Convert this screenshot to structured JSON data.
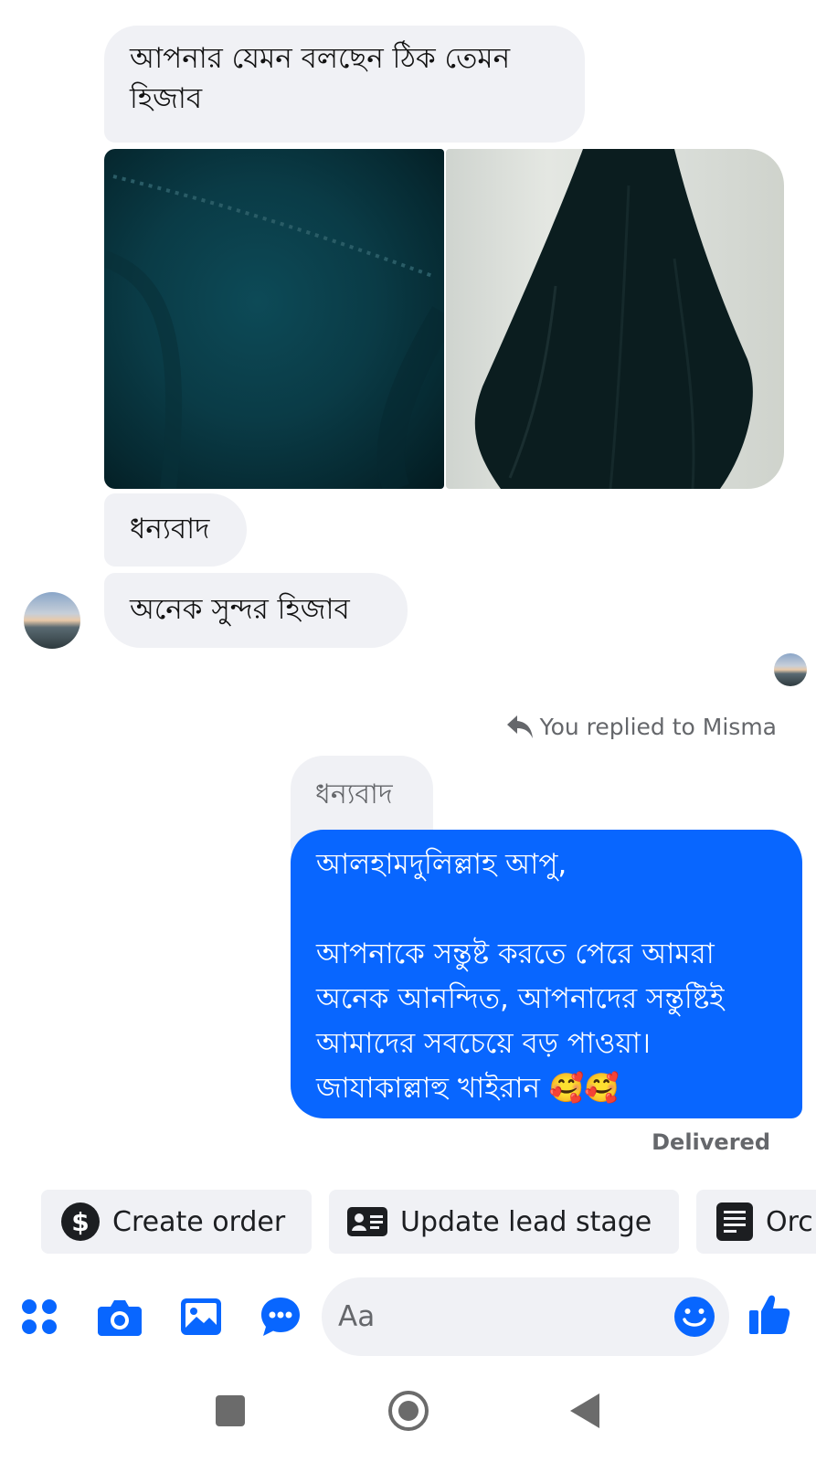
{
  "messages": {
    "incoming_1": "আপনার যেমন বলছেন ঠিক তেমন হিজাব",
    "incoming_2": "ধন্যবাদ",
    "incoming_3": "অনেক সুন্দর হিজাব"
  },
  "reply_header": "You replied to Misma",
  "quoted_message": "ধন্যবাদ",
  "outgoing_message": "আলহামদুলিল্লাহ আপু,\n\nআপনাকে সন্তুষ্ট করতে পেরে আমরা অনেক আনন্দিত, আপনাদের সন্তুষ্টিই আমাদের সবচেয়ে বড় পাওয়া।\nজাযাকাল্লাহু খাইরান 🥰🥰",
  "delivery_status": "Delivered",
  "quick_actions": [
    {
      "label": "Create order",
      "icon": "dollar-icon"
    },
    {
      "label": "Update lead stage",
      "icon": "id-card-icon"
    },
    {
      "label": "Orc",
      "icon": "receipt-icon"
    }
  ],
  "composer": {
    "placeholder": "Aa"
  },
  "colors": {
    "accent": "#0866ff",
    "incoming_bubble": "#f0f1f5",
    "secondary_text": "#65676b"
  }
}
